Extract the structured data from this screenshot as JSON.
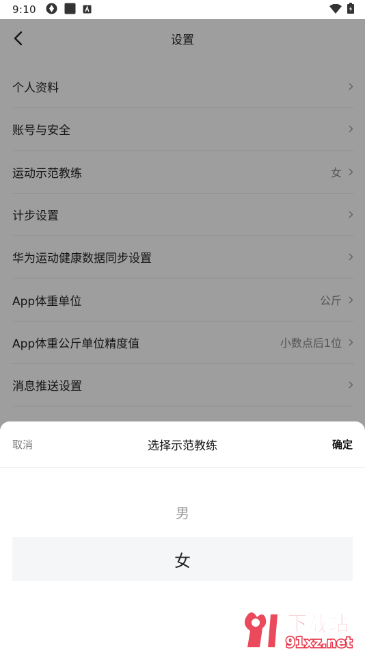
{
  "status_bar": {
    "time": "9:10"
  },
  "nav": {
    "title": "设置"
  },
  "settings": [
    {
      "label": "个人资料",
      "value": ""
    },
    {
      "label": "账号与安全",
      "value": ""
    },
    {
      "label": "运动示范教练",
      "value": "女"
    },
    {
      "label": "计步设置",
      "value": ""
    },
    {
      "label": "华为运动健康数据同步设置",
      "value": ""
    },
    {
      "label": "App体重单位",
      "value": "公斤"
    },
    {
      "label": "App体重公斤单位精度值",
      "value": "小数点后1位"
    },
    {
      "label": "消息推送设置",
      "value": ""
    }
  ],
  "sheet": {
    "cancel": "取消",
    "title": "选择示范教练",
    "confirm": "确定",
    "options": [
      "男",
      "女"
    ],
    "selected": "女"
  },
  "watermark": {
    "brand": "下载站",
    "site": "91xz.net"
  },
  "colors": {
    "overlay": "#000000",
    "watermark_red": "#e8364a"
  }
}
